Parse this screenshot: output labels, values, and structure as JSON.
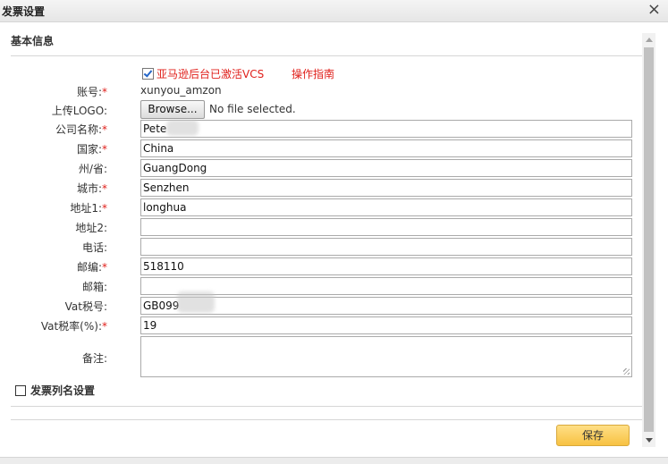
{
  "dialog": {
    "title": "发票设置",
    "close_glyph": "×"
  },
  "section": {
    "title": "基本信息"
  },
  "vcs": {
    "checked": true,
    "label": "亚马逊后台已激活VCS",
    "guide_link": "操作指南"
  },
  "form": {
    "account_label": "账号:",
    "account_value": "xunyou_amzon",
    "logo_label": "上传LOGO:",
    "browse_label": "Browse...",
    "no_file_text": "No file selected.",
    "company_label": "公司名称:",
    "company_value": "Pete",
    "country_label": "国家:",
    "country_value": "China",
    "state_label": "州/省:",
    "state_value": "GuangDong",
    "city_label": "城市:",
    "city_value": "Senzhen",
    "address1_label": "地址1:",
    "address1_value": "longhua",
    "address2_label": "地址2:",
    "address2_value": "",
    "phone_label": "电话:",
    "phone_value": "",
    "postcode_label": "邮编:",
    "postcode_value": "518110",
    "email_label": "邮箱:",
    "email_value": "",
    "vat_no_label": "Vat税号:",
    "vat_no_value": "GB099",
    "vat_rate_label": "Vat税率(%):",
    "vat_rate_value": "19",
    "remark_label": "备注:",
    "remark_value": "",
    "required_mark": "*"
  },
  "invoice_columns": {
    "checked": false,
    "label": "发票列名设置"
  },
  "save_button": "保存",
  "colors": {
    "required": "#e0201b",
    "link": "#e0201b",
    "button": "#f7c242"
  }
}
